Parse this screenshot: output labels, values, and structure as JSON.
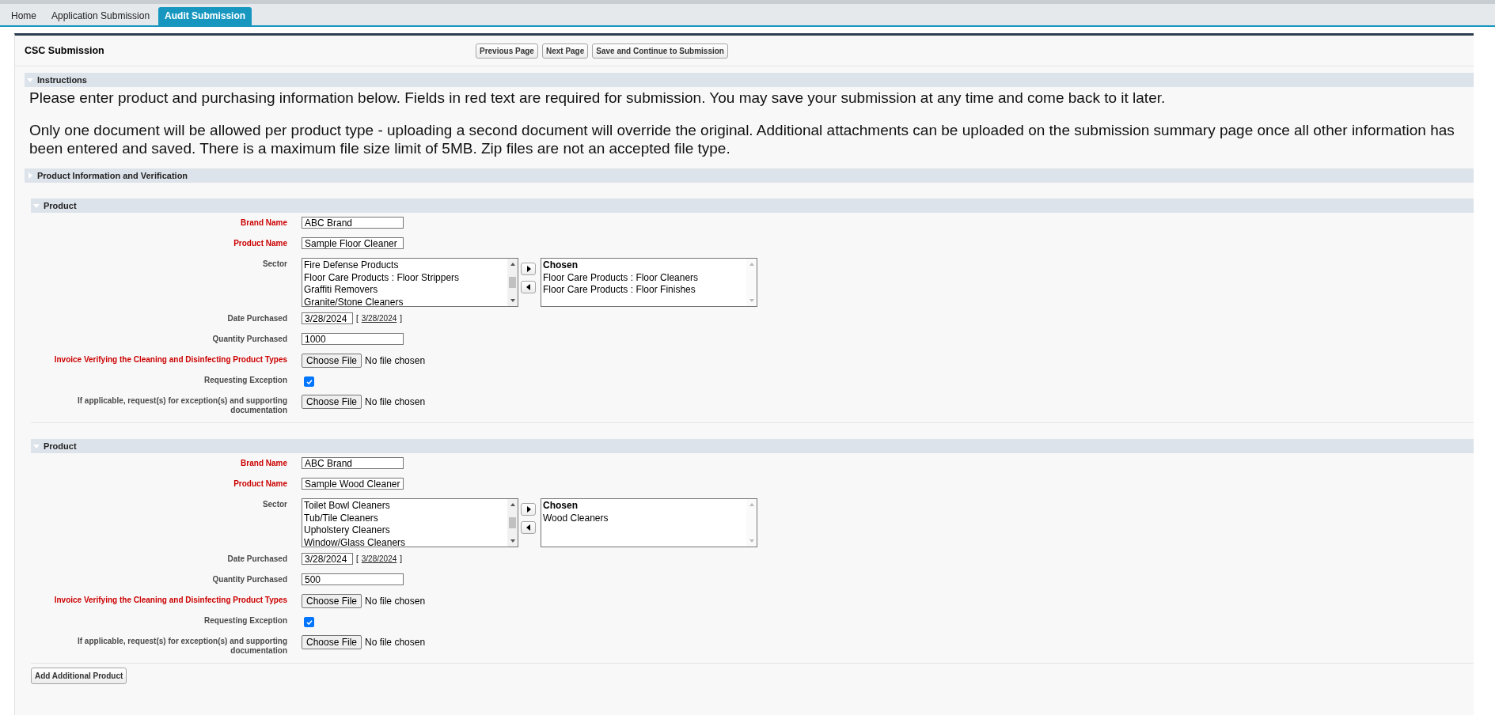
{
  "tabs": [
    {
      "label": "Home",
      "selected": false
    },
    {
      "label": "Application Submission",
      "selected": false
    },
    {
      "label": "Audit Submission",
      "selected": true
    }
  ],
  "page": {
    "title": "CSC Submission",
    "buttons": [
      "Previous Page",
      "Next Page",
      "Save and Continue to Submission"
    ]
  },
  "sections": [
    {
      "title": "Instructions",
      "expanded": true,
      "paragraphs": [
        "Please enter product and purchasing information below. Fields in red text are required for submission. You may save your submission at any time and come back to it later.",
        "Only one document will be allowed per product type - uploading a second document will override the original. Additional attachments can be uploaded on the submission summary page once all other information has been entered and saved. There is a maximum file size limit of 5MB. Zip files are not an accepted file type."
      ]
    },
    {
      "title": "Product Information and Verification",
      "expanded": false
    }
  ],
  "products": [
    {
      "title": "Product",
      "expanded": true,
      "fields": [
        {
          "kind": "text",
          "label": "Brand Name",
          "required": true,
          "value": "ABC Brand"
        },
        {
          "kind": "text",
          "label": "Product Name",
          "required": true,
          "value": "Sample Floor Cleaner"
        },
        {
          "kind": "multiselect",
          "label": "Sector",
          "required": false,
          "available": [
            "Fire Defense Products",
            "Floor Care Products : Floor Strippers",
            "Graffiti Removers",
            "Granite/Stone Cleaners"
          ],
          "chosen_header": "Chosen",
          "chosen": [
            "Floor Care Products : Floor Cleaners",
            "Floor Care Products : Floor Finishes"
          ]
        },
        {
          "kind": "date",
          "label": "Date Purchased",
          "required": false,
          "value": "3/28/2024",
          "link_prefix": "[",
          "link": "3/28/2024",
          "link_suffix": "]"
        },
        {
          "kind": "text",
          "label": "Quantity Purchased",
          "required": false,
          "value": "1000"
        },
        {
          "kind": "file",
          "label": "Invoice Verifying the Cleaning and Disinfecting Product Types",
          "required": true,
          "button": "Choose File",
          "status": "No file chosen"
        },
        {
          "kind": "checkbox",
          "label": "Requesting Exception",
          "required": false,
          "checked": true
        },
        {
          "kind": "file",
          "label": "If applicable, request(s) for exception(s) and supporting documentation",
          "required": false,
          "button": "Choose File",
          "status": "No file chosen"
        }
      ]
    },
    {
      "title": "Product",
      "expanded": true,
      "fields": [
        {
          "kind": "text",
          "label": "Brand Name",
          "required": true,
          "value": "ABC Brand"
        },
        {
          "kind": "text",
          "label": "Product Name",
          "required": true,
          "value": "Sample Wood Cleaner"
        },
        {
          "kind": "multiselect",
          "label": "Sector",
          "required": false,
          "available": [
            "Toilet Bowl Cleaners",
            "Tub/Tile Cleaners",
            "Upholstery Cleaners",
            "Window/Glass Cleaners"
          ],
          "chosen_header": "Chosen",
          "chosen": [
            "Wood Cleaners"
          ]
        },
        {
          "kind": "date",
          "label": "Date Purchased",
          "required": false,
          "value": "3/28/2024",
          "link_prefix": "[",
          "link": "3/28/2024",
          "link_suffix": "]"
        },
        {
          "kind": "text",
          "label": "Quantity Purchased",
          "required": false,
          "value": "500"
        },
        {
          "kind": "file",
          "label": "Invoice Verifying the Cleaning and Disinfecting Product Types",
          "required": true,
          "button": "Choose File",
          "status": "No file chosen"
        },
        {
          "kind": "checkbox",
          "label": "Requesting Exception",
          "required": false,
          "checked": true
        },
        {
          "kind": "file",
          "label": "If applicable, request(s) for exception(s) and supporting documentation",
          "required": false,
          "button": "Choose File",
          "status": "No file chosen"
        }
      ]
    }
  ],
  "add_button": "Add Additional Product"
}
